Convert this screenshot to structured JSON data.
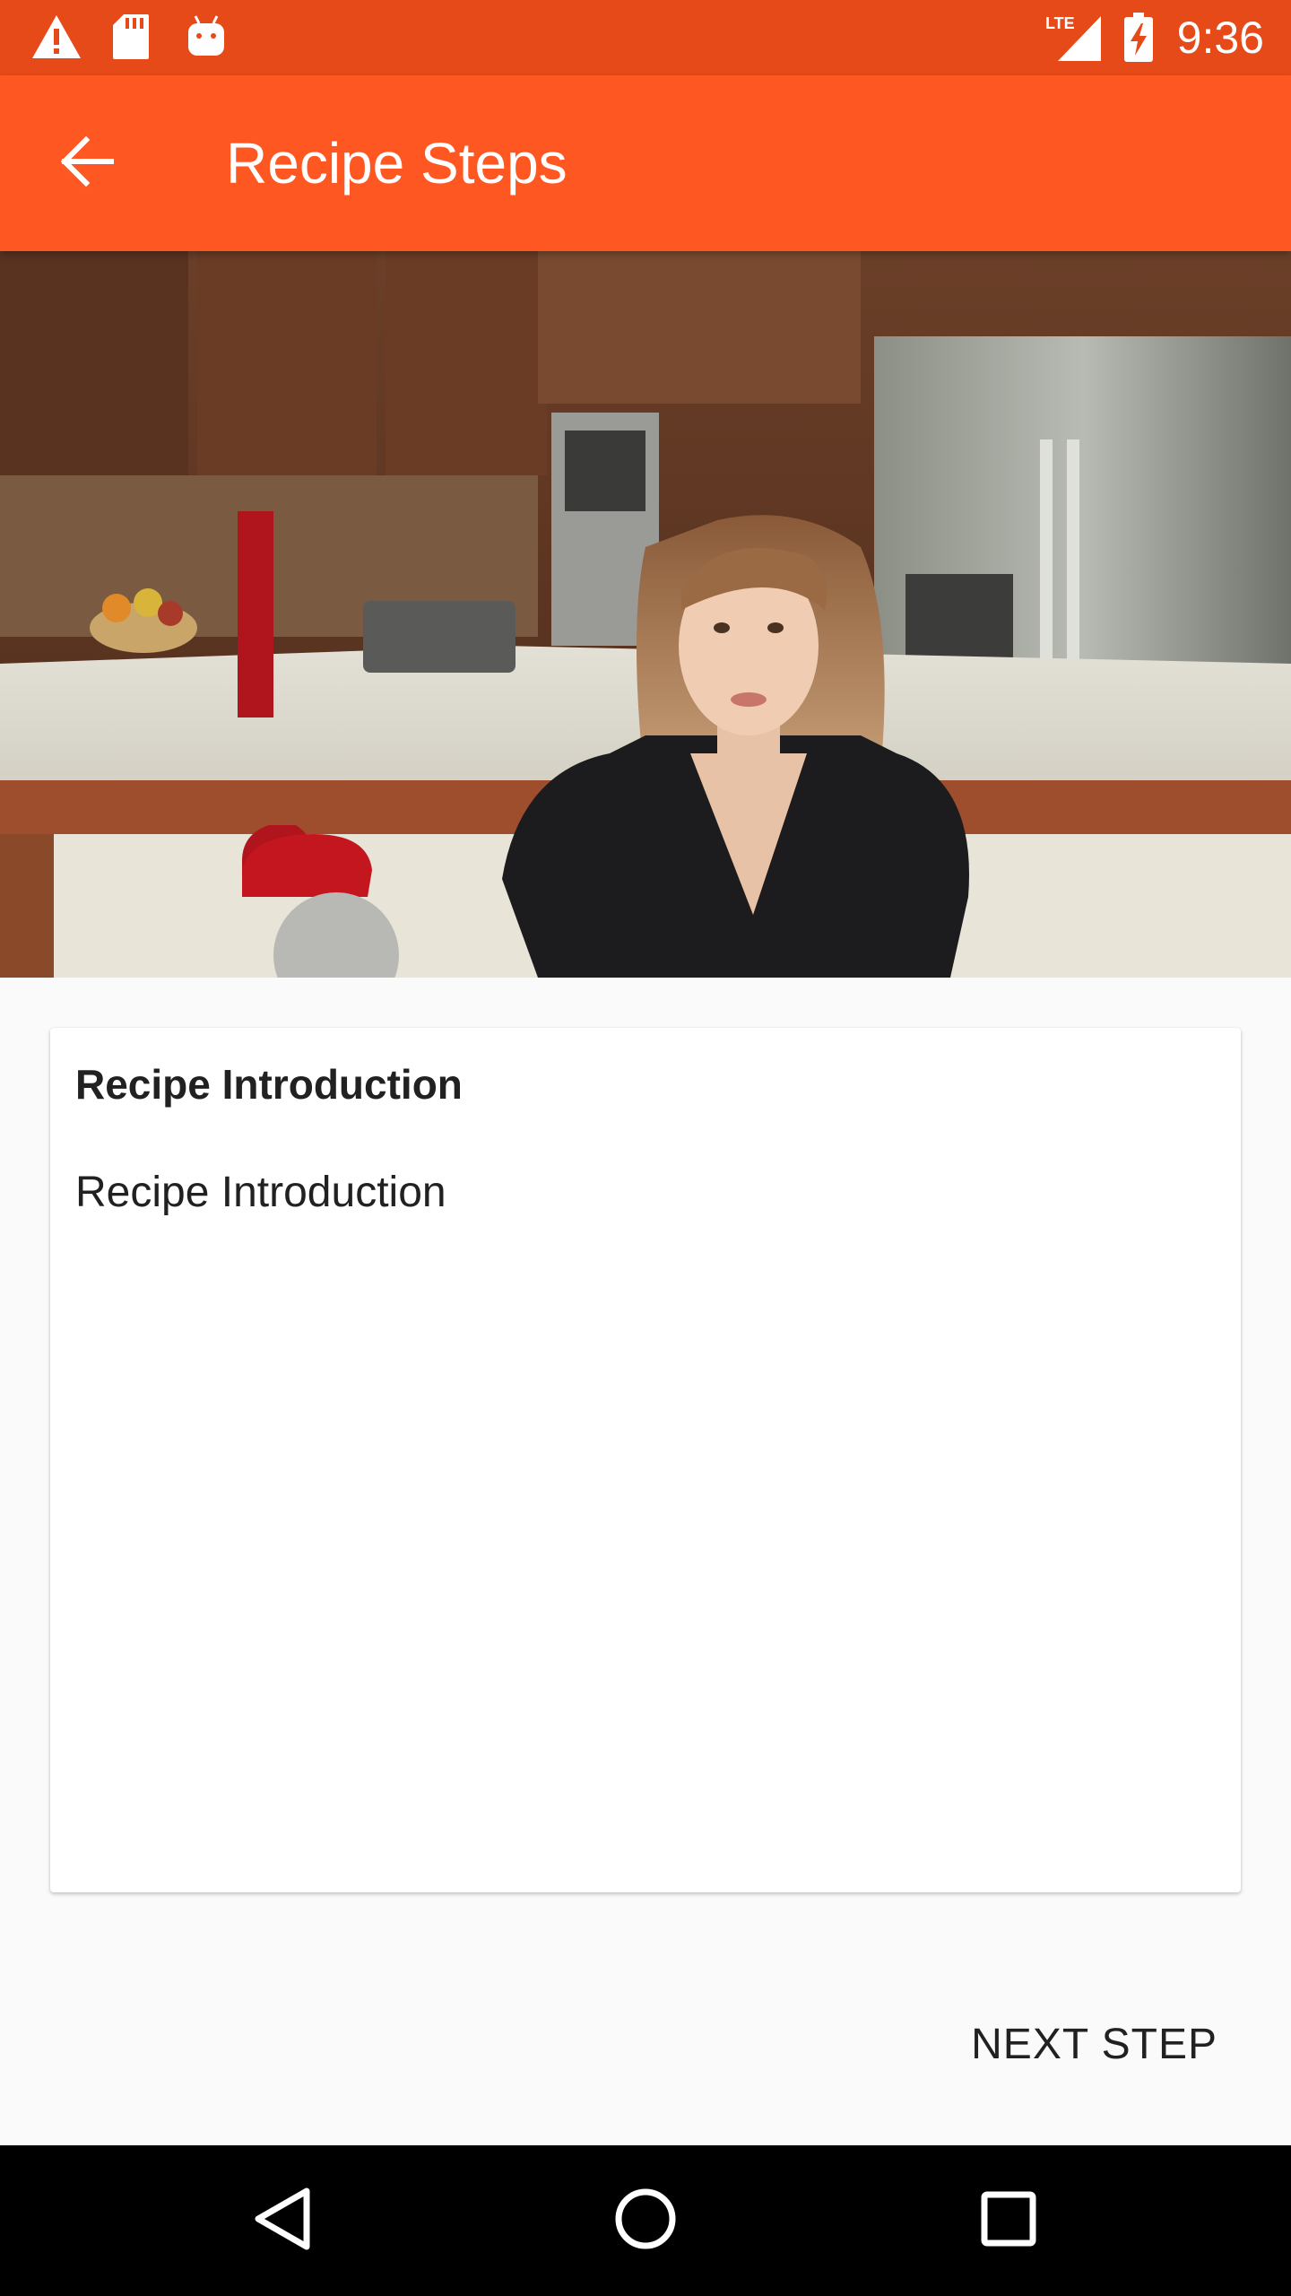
{
  "status_bar": {
    "time": "9:36",
    "network": "LTE",
    "icons": [
      "warning-icon",
      "sd-card-icon",
      "android-debug-icon",
      "signal-icon",
      "battery-charging-icon"
    ]
  },
  "app_bar": {
    "title": "Recipe Steps",
    "back_icon": "arrow-back-icon"
  },
  "video": {
    "description_icon": "video-frame"
  },
  "step": {
    "short_description": "Recipe Introduction",
    "description": "Recipe Introduction"
  },
  "actions": {
    "next_label": "NEXT STEP"
  },
  "nav_bar": {
    "icons": [
      "back-triangle-icon",
      "home-circle-icon",
      "recents-square-icon"
    ]
  },
  "colors": {
    "status_bar": "#e64a19",
    "app_bar": "#ff5722",
    "background": "#fafafa"
  }
}
